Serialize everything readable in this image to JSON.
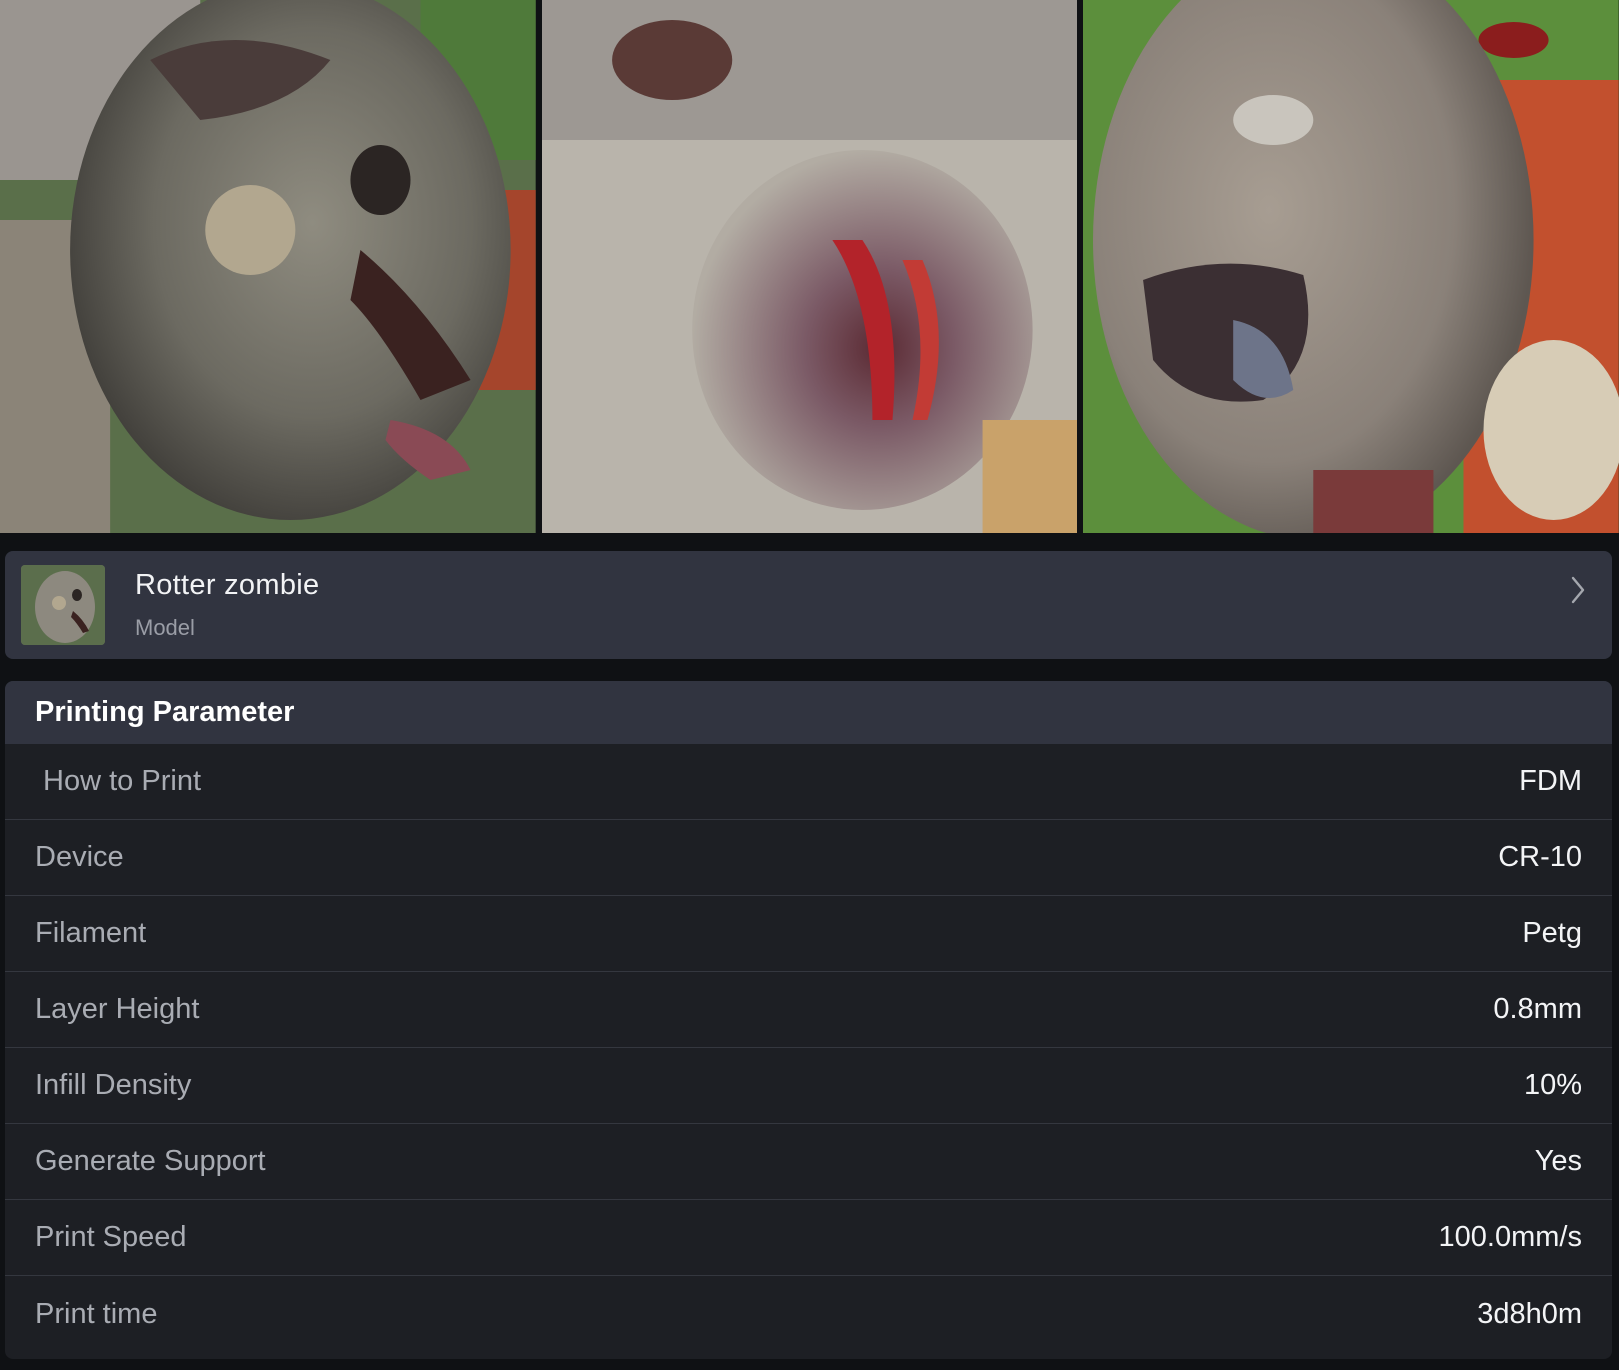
{
  "gallery": {
    "photos": [
      {
        "name": "zombie-photo-1"
      },
      {
        "name": "zombie-photo-2"
      },
      {
        "name": "zombie-photo-3"
      }
    ]
  },
  "model": {
    "title": "Rotter zombie",
    "subtitle": "Model",
    "chevron_icon": "chevron-right-icon"
  },
  "printing": {
    "header": "Printing Parameter",
    "rows": [
      {
        "label": " How to Print",
        "value": "FDM"
      },
      {
        "label": "Device",
        "value": "CR-10"
      },
      {
        "label": "Filament",
        "value": "Petg"
      },
      {
        "label": "Layer Height",
        "value": "0.8mm"
      },
      {
        "label": "Infill Density",
        "value": "10%"
      },
      {
        "label": "Generate Support",
        "value": "Yes"
      },
      {
        "label": "Print Speed",
        "value": "100.0mm/s"
      },
      {
        "label": "Print time",
        "value": "3d8h0m"
      }
    ]
  },
  "colors": {
    "background": "#0f1114",
    "card": "#313440",
    "panel": "#1d1f24",
    "label_text": "#a9acb3",
    "value_text": "#f3f4f6"
  }
}
